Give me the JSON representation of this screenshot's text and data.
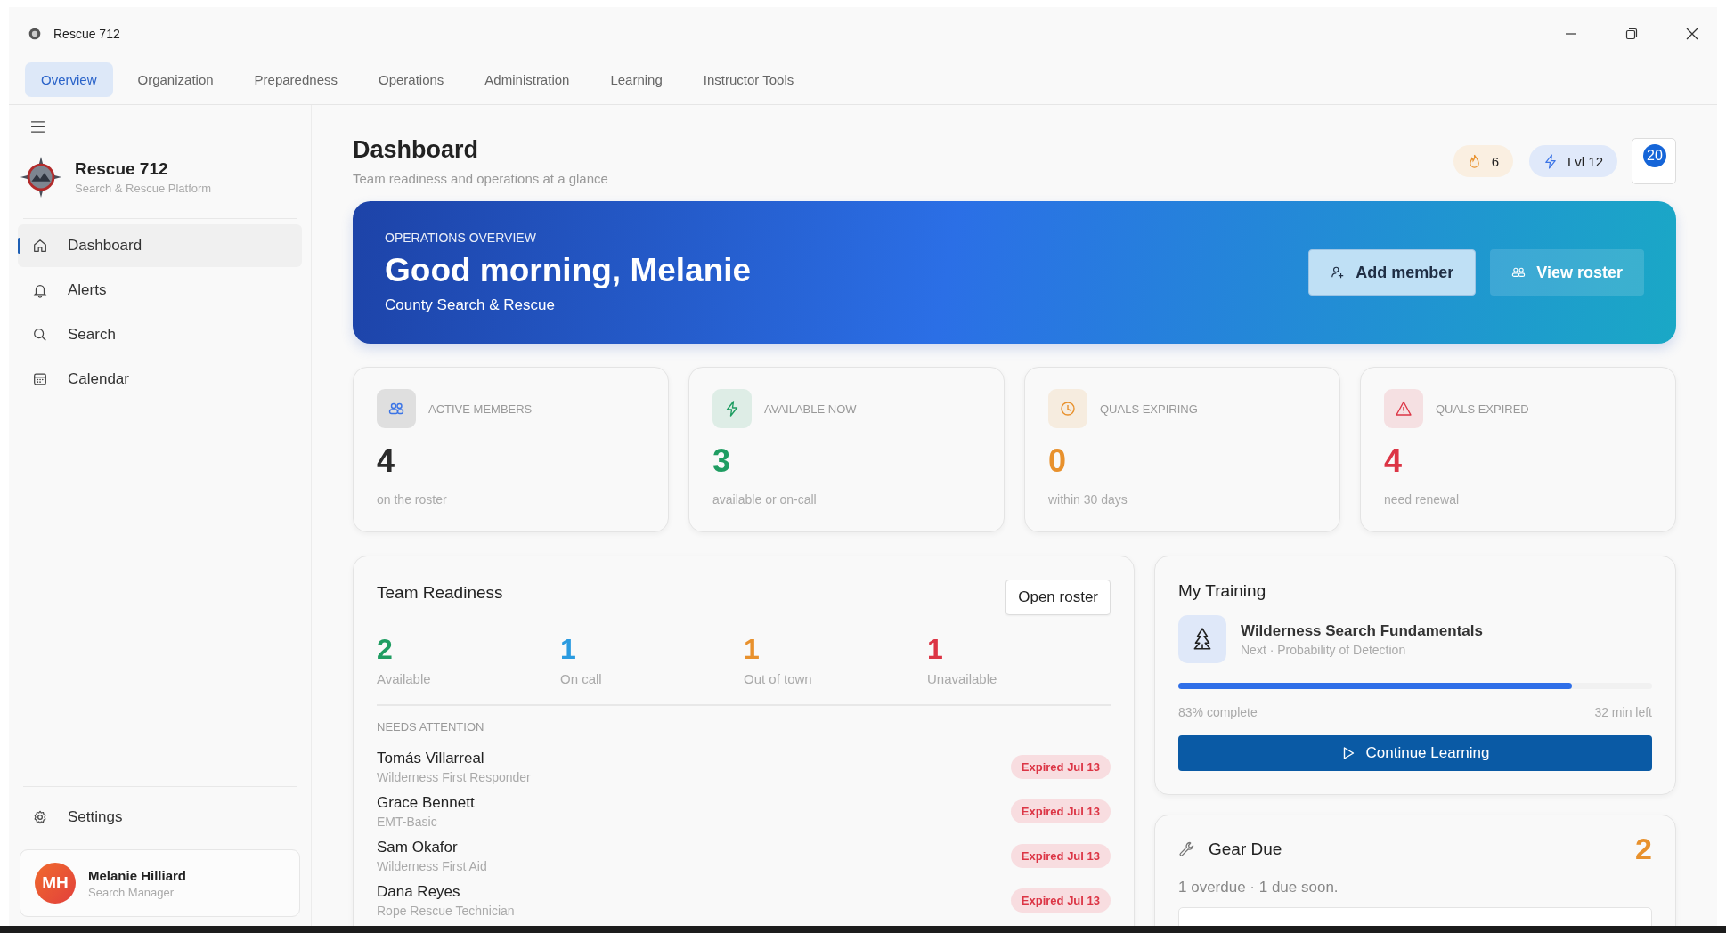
{
  "window": {
    "title": "Rescue 712"
  },
  "tabs": [
    {
      "label": "Overview",
      "selected": true
    },
    {
      "label": "Organization",
      "selected": false
    },
    {
      "label": "Preparedness",
      "selected": false
    },
    {
      "label": "Operations",
      "selected": false
    },
    {
      "label": "Administration",
      "selected": false
    },
    {
      "label": "Learning",
      "selected": false
    },
    {
      "label": "Instructor Tools",
      "selected": false
    }
  ],
  "sidebar": {
    "brand": "Rescue 712",
    "tagline": "Search & Rescue Platform",
    "items": [
      {
        "label": "Dashboard",
        "selected": true
      },
      {
        "label": "Alerts",
        "selected": false
      },
      {
        "label": "Search",
        "selected": false
      },
      {
        "label": "Calendar",
        "selected": false
      }
    ],
    "settings": "Settings",
    "user": {
      "initials": "MH",
      "name": "Melanie Hilliard",
      "role": "Search Manager"
    }
  },
  "header": {
    "title": "Dashboard",
    "subtitle": "Team readiness and operations at a glance",
    "streak": "6",
    "level": "Lvl 12",
    "notifications": "20"
  },
  "banner": {
    "eyebrow": "OPERATIONS OVERVIEW",
    "greeting": "Good morning, Melanie",
    "org": "County Search & Rescue",
    "buttons": [
      {
        "label": "Add member",
        "kind": "primary"
      },
      {
        "label": "View roster",
        "kind": "secondary"
      }
    ]
  },
  "stats": [
    {
      "label": "ACTIVE MEMBERS",
      "value": "4",
      "note": "on the roster",
      "color": "#2b2b2b"
    },
    {
      "label": "AVAILABLE NOW",
      "value": "3",
      "note": "available or on-call",
      "color": "#1f9d62"
    },
    {
      "label": "QUALS EXPIRING",
      "value": "0",
      "note": "within 30 days",
      "color": "#e8912d"
    },
    {
      "label": "QUALS EXPIRED",
      "value": "4",
      "note": "need renewal",
      "color": "#dc3545"
    }
  ],
  "readiness": {
    "title": "Team Readiness",
    "button": "Open roster",
    "counts": [
      {
        "value": "2",
        "label": "Available",
        "color": "#1f9d62"
      },
      {
        "value": "1",
        "label": "On call",
        "color": "#2b9be0"
      },
      {
        "value": "1",
        "label": "Out of town",
        "color": "#e8912d"
      },
      {
        "value": "1",
        "label": "Unavailable",
        "color": "#dc3545"
      }
    ],
    "attention_title": "NEEDS ATTENTION",
    "attention": [
      {
        "name": "Tomás Villarreal",
        "qual": "Wilderness First Responder",
        "status": "Expired Jul 13"
      },
      {
        "name": "Grace Bennett",
        "qual": "EMT-Basic",
        "status": "Expired Jul 13"
      },
      {
        "name": "Sam Okafor",
        "qual": "Wilderness First Aid",
        "status": "Expired Jul 13"
      },
      {
        "name": "Dana Reyes",
        "qual": "Rope Rescue Technician",
        "status": "Expired Jul 13"
      }
    ]
  },
  "training": {
    "title": "My Training",
    "course": "Wilderness Search Fundamentals",
    "next": "Next · Probability of Detection",
    "level": 0.83,
    "progress": "83% complete",
    "remaining": "32 min left",
    "button": "Continue Learning"
  },
  "gear": {
    "title": "Gear Due",
    "count": "2",
    "summary": "1 overdue · 1 due soon."
  }
}
